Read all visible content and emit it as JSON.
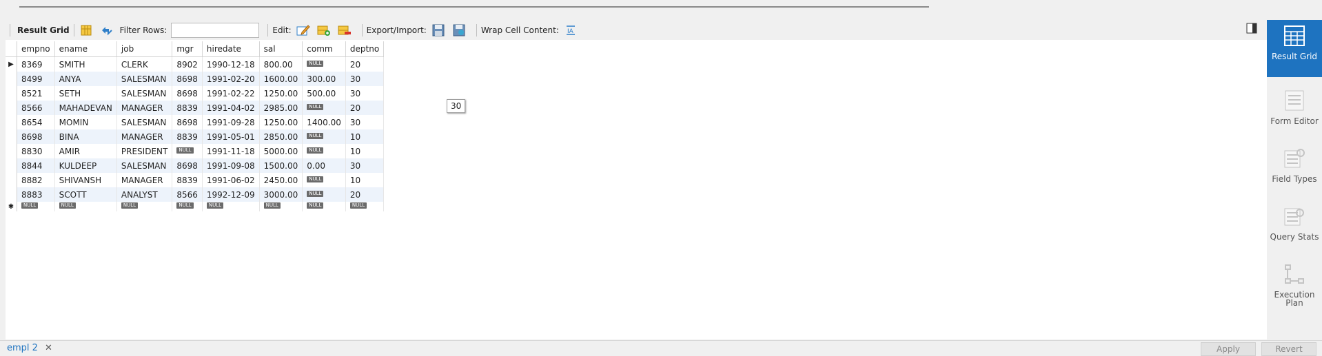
{
  "toolbar": {
    "result_grid_label": "Result Grid",
    "filter_rows_label": "Filter Rows:",
    "filter_rows_value": "",
    "edit_label": "Edit:",
    "export_import_label": "Export/Import:",
    "wrap_cell_label": "Wrap Cell Content:"
  },
  "table": {
    "columns": [
      "empno",
      "ename",
      "job",
      "mgr",
      "hiredate",
      "sal",
      "comm",
      "deptno"
    ],
    "rows": [
      [
        "8369",
        "SMITH",
        "CLERK",
        "8902",
        "1990-12-18",
        "800.00",
        "NULL",
        "20"
      ],
      [
        "8499",
        "ANYA",
        "SALESMAN",
        "8698",
        "1991-02-20",
        "1600.00",
        "300.00",
        "30"
      ],
      [
        "8521",
        "SETH",
        "SALESMAN",
        "8698",
        "1991-02-22",
        "1250.00",
        "500.00",
        "30"
      ],
      [
        "8566",
        "MAHADEVAN",
        "MANAGER",
        "8839",
        "1991-04-02",
        "2985.00",
        "NULL",
        "20"
      ],
      [
        "8654",
        "MOMIN",
        "SALESMAN",
        "8698",
        "1991-09-28",
        "1250.00",
        "1400.00",
        "30"
      ],
      [
        "8698",
        "BINA",
        "MANAGER",
        "8839",
        "1991-05-01",
        "2850.00",
        "NULL",
        "10"
      ],
      [
        "8830",
        "AMIR",
        "PRESIDENT",
        "NULL",
        "1991-11-18",
        "5000.00",
        "NULL",
        "10"
      ],
      [
        "8844",
        "KULDEEP",
        "SALESMAN",
        "8698",
        "1991-09-08",
        "1500.00",
        "0.00",
        "30"
      ],
      [
        "8882",
        "SHIVANSH",
        "MANAGER",
        "8839",
        "1991-06-02",
        "2450.00",
        "NULL",
        "10"
      ],
      [
        "8883",
        "SCOTT",
        "ANALYST",
        "8566",
        "1992-12-09",
        "3000.00",
        "NULL",
        "20"
      ]
    ],
    "new_row": [
      "NULL",
      "NULL",
      "NULL",
      "NULL",
      "NULL",
      "NULL",
      "NULL",
      "NULL"
    ],
    "current_row_marker": "▶",
    "new_row_marker": "✱"
  },
  "tooltip": "30",
  "right_panel": {
    "items": [
      {
        "label": "Result Grid",
        "icon": "result-grid-icon"
      },
      {
        "label": "Form Editor",
        "icon": "form-editor-icon"
      },
      {
        "label": "Field Types",
        "icon": "field-types-icon"
      },
      {
        "label": "Query Stats",
        "icon": "query-stats-icon"
      },
      {
        "label": "Execution Plan",
        "icon": "execution-plan-icon"
      }
    ]
  },
  "bottom": {
    "tab_label": "empl 2",
    "close_glyph": "✕",
    "apply_label": "Apply",
    "revert_label": "Revert"
  },
  "colors": {
    "accent": "#1e73c0",
    "row_alt": "#edf3fb",
    "null_badge": "#6b6b6b"
  }
}
